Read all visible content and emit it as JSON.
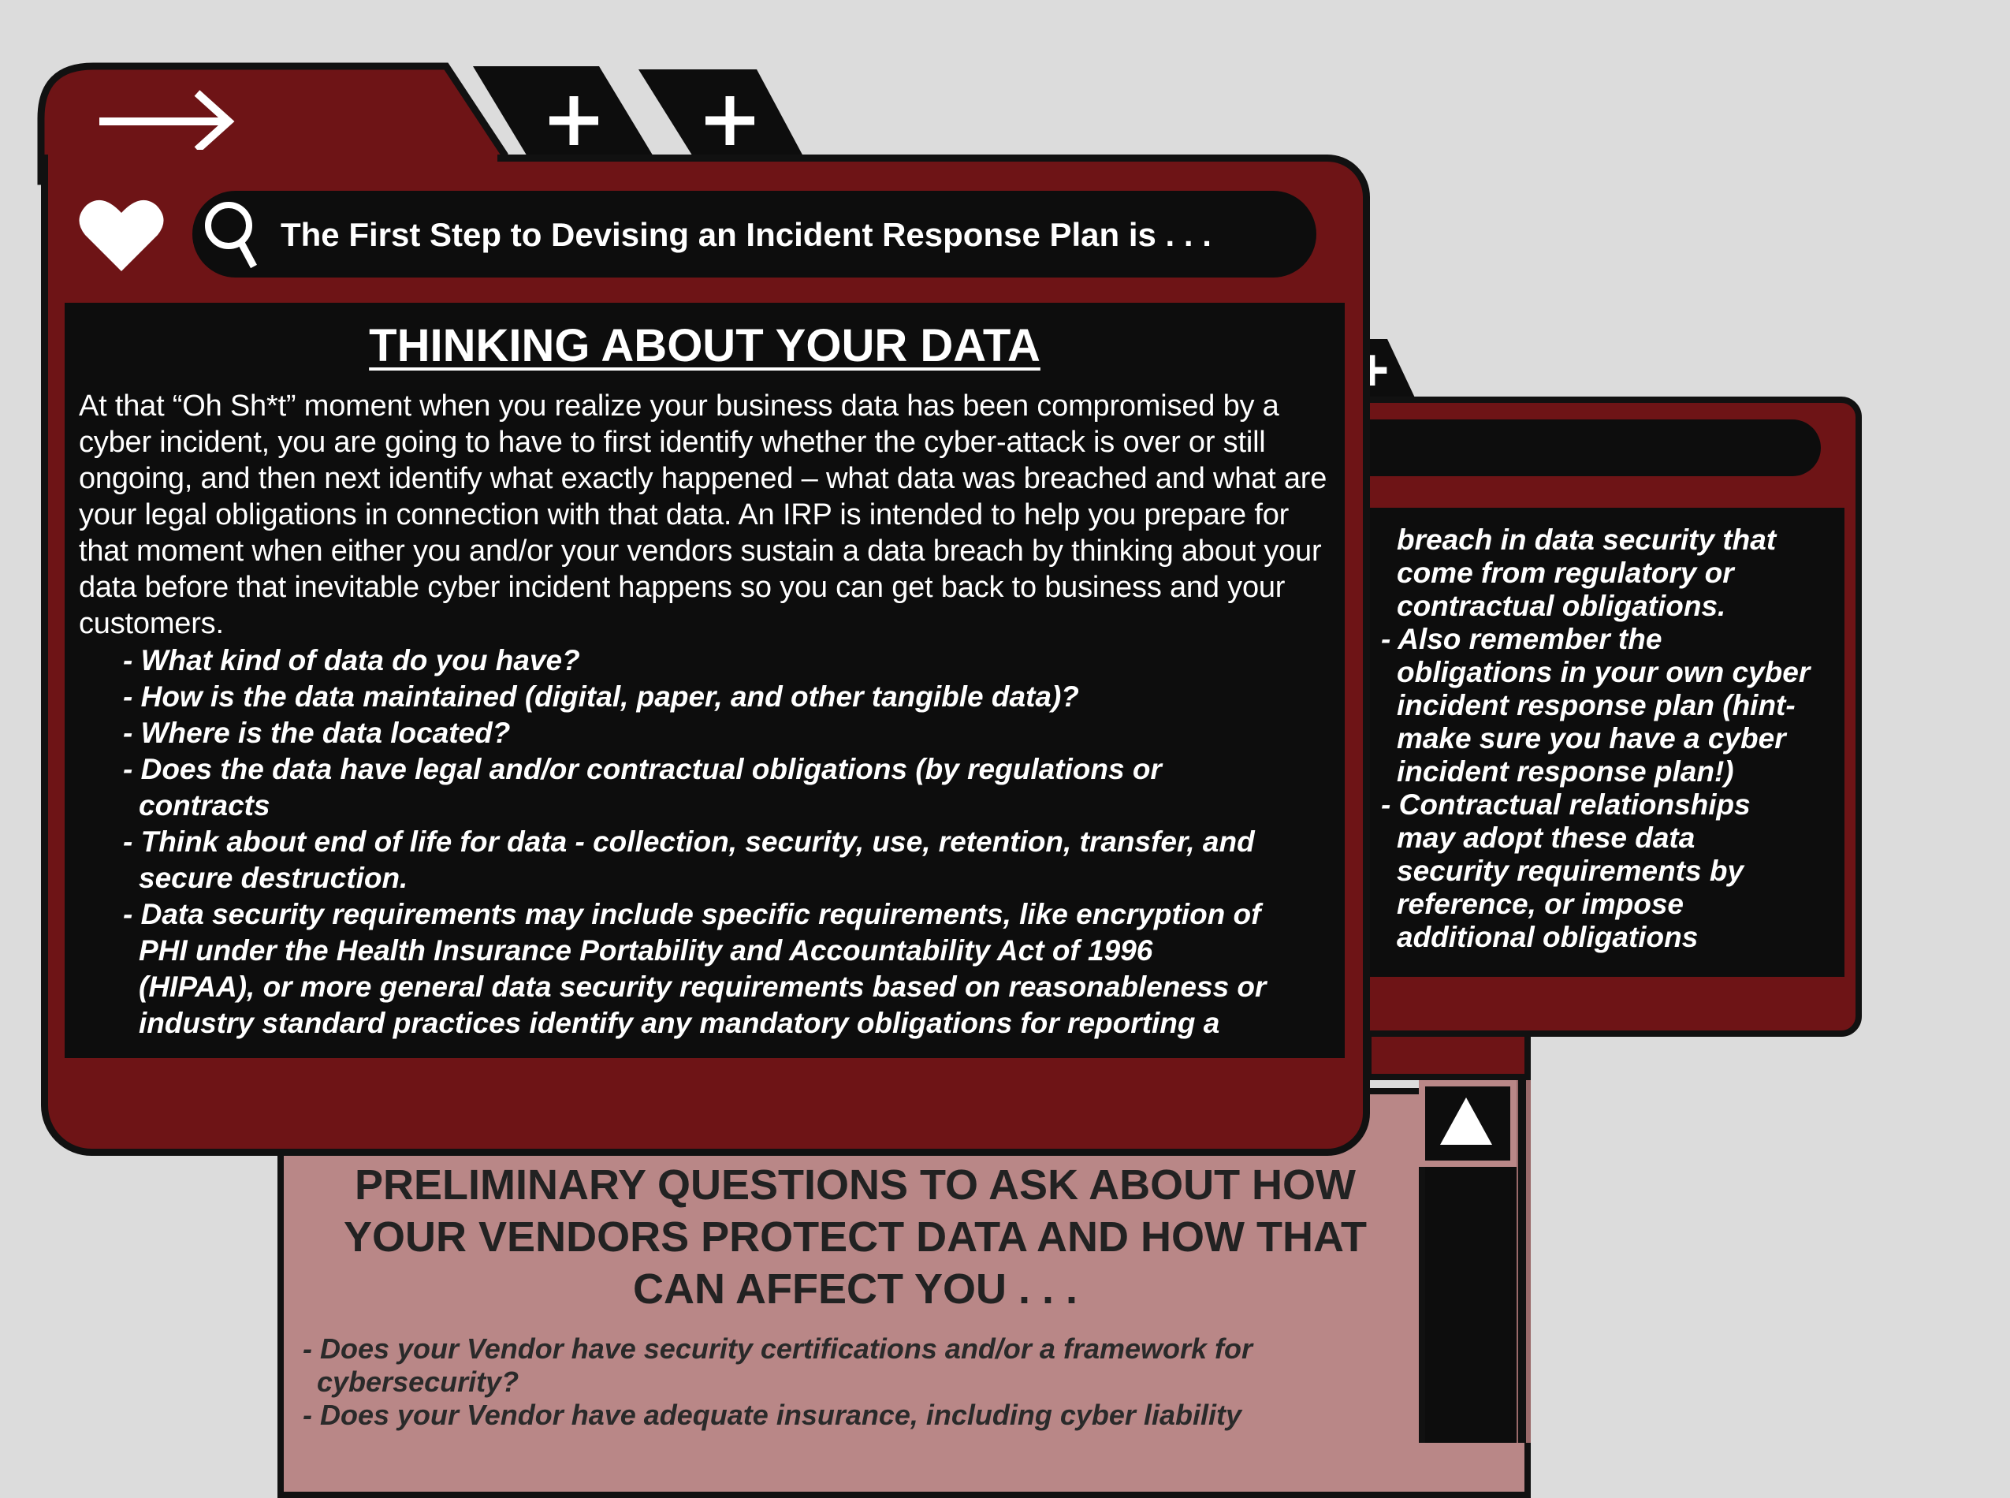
{
  "main_window": {
    "search_text": "The First Step to Devising an Incident Response Plan is . . .",
    "heading": "THINKING ABOUT YOUR DATA",
    "intro": "At that “Oh Sh*t” moment when you realize your business data has been compromised by a cyber incident, you are going to have to first identify whether the cyber-attack is over or still ongoing, and then next identify what exactly happened – what data was breached and what are your legal obligations in connection with that data.  An IRP  is intended to help you prepare for that moment when either you and/or your vendors sustain a data breach by thinking about your data before  that inevitable cyber incident happens so you can get back to business and your customers.",
    "bullets": [
      "- What kind of data do you have?",
      "- How is the data maintained (digital, paper, and other tangible data)?",
      "- Where is the data located?",
      "- Does the data have legal and/or contractual obligations (by regulations or contracts",
      "- Think about end of life for data - collection, security, use, retention, transfer, and secure destruction.",
      "- Data security requirements may include specific requirements, like encryption of PHI under the Health Insurance Portability and Accountability Act of 1996 (HIPAA), or more general data security requirements based on reasonableness or industry standard practices identify any mandatory obligations for reporting a"
    ]
  },
  "back_window": {
    "lines": [
      "breach in data security that",
      "come from regulatory or",
      "contractual obligations.",
      "- Also remember the",
      "obligations in your own cyber",
      "incident response plan (hint-",
      "make sure you have a cyber",
      "incident response plan!)",
      "- Contractual relationships",
      "may adopt these data",
      "security requirements by",
      "reference, or impose",
      "additional obligations"
    ]
  },
  "vendor_window": {
    "title": "PRELIMINARY QUESTIONS TO ASK ABOUT HOW YOUR VENDORS PROTECT DATA AND HOW THAT CAN AFFECT YOU . . .",
    "items": [
      "- Does your Vendor have security certifications and/or a framework for",
      "cybersecurity?",
      "- Does your Vendor have adequate insurance, including cyber liability"
    ]
  },
  "icons": [
    "arrow-right-icon",
    "plus-icon",
    "heart-icon",
    "search-icon",
    "scroll-up-icon"
  ],
  "colors": {
    "window_red": "#6e1416",
    "panel_black": "#0d0d0d",
    "vendor_pink": "#b98787",
    "background": "#dcdcdc"
  }
}
